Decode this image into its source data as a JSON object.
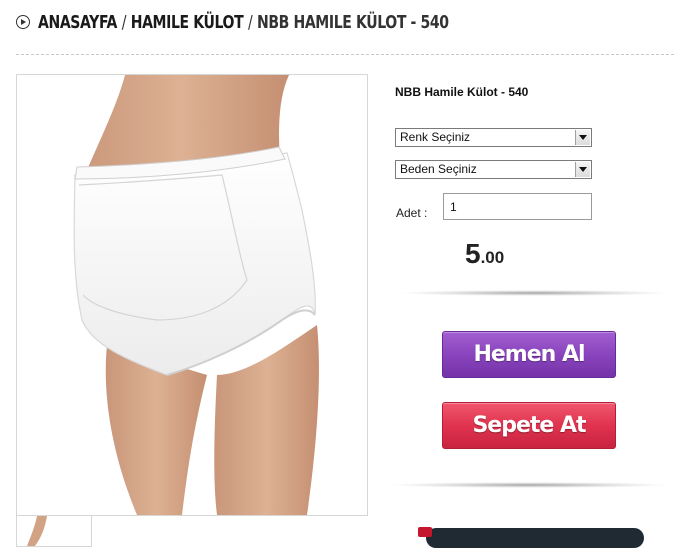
{
  "breadcrumb": {
    "home": "ANASAYFA",
    "category": "HAMILE KÜLOT",
    "current": "NBB HAMILE KÜLOT - 540",
    "separator": "/"
  },
  "product": {
    "title": "NBB Hamile Külot - 540",
    "color_select": {
      "selected": "Renk Seçiniz"
    },
    "size_select": {
      "selected": "Beden Seçiniz"
    },
    "quantity_label": "Adet :",
    "quantity_value": "1",
    "price_integer": "5",
    "price_decimal": ".00"
  },
  "actions": {
    "buy_now_label": "Hemen Al",
    "add_to_cart_label": "Sepete At"
  },
  "colors": {
    "buy_now": "#8a44bd",
    "add_to_cart": "#e0334f"
  }
}
